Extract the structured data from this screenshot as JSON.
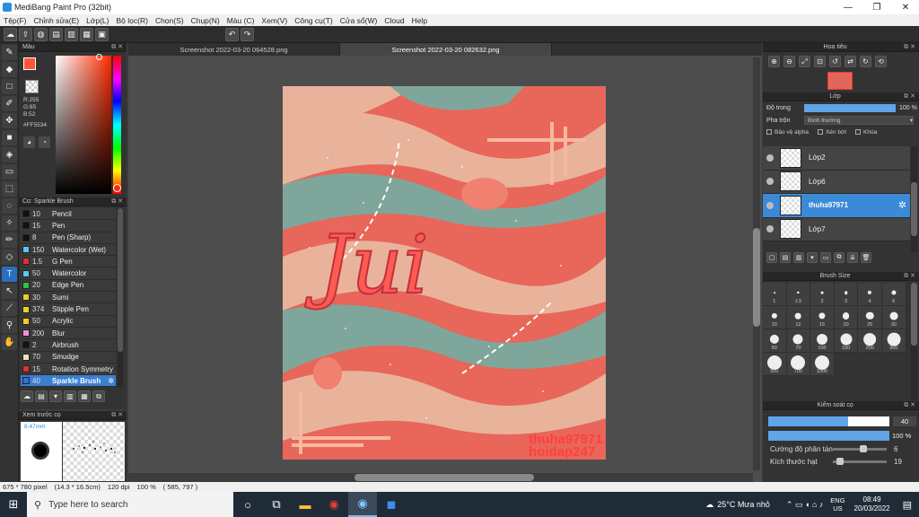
{
  "window": {
    "title": "MediBang Paint Pro (32bit)",
    "minimize": "—",
    "maximize": "❐",
    "close": "✕"
  },
  "menu": [
    "Tệp(F)",
    "Chỉnh sửa(E)",
    "Lớp(L)",
    "Bộ lọc(R)",
    "Chọn(S)",
    "Chụp(N)",
    "Màu (C)",
    "Xem(V)",
    "Công cụ(T)",
    "Cửa sổ(W)",
    "Cloud",
    "Help"
  ],
  "color_panel": {
    "title": "Màu",
    "r": "R:255",
    "g": "G:85",
    "b": "B:52",
    "hex": "#FF5534",
    "fg_color": "#ff5534"
  },
  "brush_panel": {
    "title": "Cọ: Sparkle Brush",
    "brushes": [
      {
        "size": "10",
        "name": "Pencil",
        "color": "#111111"
      },
      {
        "size": "15",
        "name": "Pen",
        "color": "#111111"
      },
      {
        "size": "8",
        "name": "Pen (Sharp)",
        "color": "#111111"
      },
      {
        "size": "150",
        "name": "Watercolor (Wet)",
        "color": "#5ac8f0"
      },
      {
        "size": "1.5",
        "name": "G Pen",
        "color": "#e03030"
      },
      {
        "size": "50",
        "name": "Watercolor",
        "color": "#5ac8f0"
      },
      {
        "size": "20",
        "name": "Edge Pen",
        "color": "#30c040"
      },
      {
        "size": "30",
        "name": "Sumi",
        "color": "#f0d020"
      },
      {
        "size": "374",
        "name": "Stipple Pen",
        "color": "#f0d020"
      },
      {
        "size": "50",
        "name": "Acrylic",
        "color": "#f0d020"
      },
      {
        "size": "200",
        "name": "Blur",
        "color": "#f090e0"
      },
      {
        "size": "2",
        "name": "Airbrush",
        "color": "#111111"
      },
      {
        "size": "70",
        "name": "Smudge",
        "color": "#f0e0c0"
      },
      {
        "size": "15",
        "name": "Rotation Symmetry",
        "color": "#e03030"
      },
      {
        "size": "40",
        "name": "Sparkle Brush",
        "color": "#3070e0"
      }
    ]
  },
  "preview_panel": {
    "title": "Xem trước cọ",
    "size": "8.47mm"
  },
  "tabs": [
    "Screenshot 2022-03-20 064528.png",
    "Screenshot 2022-03-20 082632.png"
  ],
  "canvas": {
    "title_text": "Jui",
    "watermark_1": "thuha97971",
    "watermark_2": "hoidap247"
  },
  "navigator": {
    "title": "Hoa tiêu"
  },
  "layer_panel": {
    "title": "Lớp",
    "opacity_label": "Độ trong",
    "opacity_value": "100 %",
    "opacity_fraction": 1.0,
    "blend_label": "Pha trộn",
    "blend_value": "Bình thường",
    "protect_alpha": "Bảo vệ alpha",
    "clipping": "Xén bớt",
    "lock": "Khóa",
    "layers": [
      {
        "name": "Lớp2",
        "selected": false
      },
      {
        "name": "Lớp6",
        "selected": false
      },
      {
        "name": "thuha97971",
        "selected": true
      },
      {
        "name": "Lớp7",
        "selected": false
      }
    ]
  },
  "brush_size_panel": {
    "title": "Brush Size",
    "sizes": [
      "1",
      "1.5",
      "2",
      "3",
      "4",
      "6",
      "10",
      "12",
      "15",
      "20",
      "25",
      "30",
      "50",
      "70",
      "100",
      "150",
      "200",
      "300",
      "500",
      "700",
      "1000"
    ]
  },
  "control_panel": {
    "title": "Kiểm soát cọ",
    "size_value": "40",
    "size_fraction": 0.66,
    "opacity_value": "100 %",
    "opacity_fraction": 1.0,
    "scatter_label": "Cường độ phân tán",
    "scatter_value": "6",
    "particle_label": "Kích thước hạt",
    "particle_value": "19"
  },
  "status": {
    "size_px": "675 * 780 pixel",
    "size_cm": "(14.3 * 16.5cm)",
    "dpi": "120 dpi",
    "zoom": "100 %",
    "coords": "( 585, 797 )"
  },
  "taskbar": {
    "search_placeholder": "Type here to search",
    "weather": "25°C  Mưa nhỏ",
    "lang_1": "ENG",
    "lang_2": "US",
    "time": "08:49",
    "date": "20/03/2022"
  }
}
